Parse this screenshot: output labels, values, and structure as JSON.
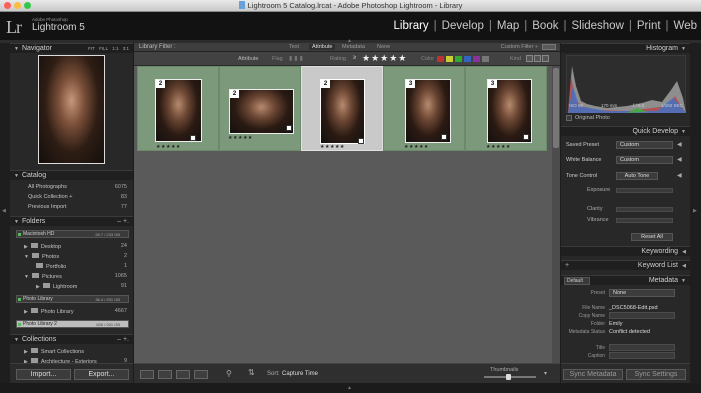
{
  "window": {
    "title": "Lightroom 5 Catalog.lrcat - Adobe Photoshop Lightroom - Library"
  },
  "identity": {
    "logo": "Lr",
    "small": "Adobe Photoshop",
    "name": "Lightroom 5"
  },
  "modules": [
    "Library",
    "Develop",
    "Map",
    "Book",
    "Slideshow",
    "Print",
    "Web"
  ],
  "active_module": "Library",
  "navigator": {
    "title": "Navigator",
    "zoom": [
      "FIT",
      "FILL",
      "1:1",
      "3:1"
    ]
  },
  "catalog": {
    "title": "Catalog",
    "items": [
      {
        "label": "All Photographs",
        "count": "6075"
      },
      {
        "label": "Quick Collection +",
        "count": "83"
      },
      {
        "label": "Previous Import",
        "count": "77"
      }
    ]
  },
  "folders": {
    "title": "Folders",
    "volume1": {
      "name": "Macintosh HD",
      "size": "28.7 / 233 GB"
    },
    "items": [
      {
        "label": "Desktop",
        "count": "24"
      },
      {
        "label": "Photos",
        "count": "2"
      },
      {
        "label": "Portfolio",
        "count": "1"
      },
      {
        "label": "Pictures",
        "count": "1065"
      },
      {
        "label": "Lightroom",
        "count": "91"
      }
    ],
    "volume2": {
      "name": "Photo Library",
      "size": "38.4 / 931 GB"
    },
    "vol2_item": {
      "label": "Photo Library",
      "count": "4667"
    },
    "volume3": {
      "name": "Photo Library 2",
      "size": "826 / 931 GB"
    }
  },
  "collections": {
    "title": "Collections",
    "items": [
      {
        "label": "Smart Collections"
      },
      {
        "label": "Architecture - Exteriors",
        "count": "9"
      }
    ]
  },
  "left_buttons": {
    "import": "Import...",
    "export": "Export..."
  },
  "filter": {
    "label": "Library Filter :",
    "tabs": [
      "Text",
      "Attribute",
      "Metadata",
      "None"
    ],
    "preset": "Custom Filter ÷",
    "attribute": "Attribute",
    "flag": "Flag",
    "rating": "Rating",
    "rating_op": "≥",
    "stars": "★★★★★",
    "color": "Color",
    "kind": "Kind"
  },
  "grid": {
    "cells": [
      {
        "index": "2",
        "stars": "★★★★★",
        "selected": false
      },
      {
        "index": "2",
        "stars": "★★★★★",
        "selected": false
      },
      {
        "index": "2",
        "stars": "★★★★★",
        "selected": true
      },
      {
        "index": "3",
        "stars": "★★★★★",
        "selected": false
      },
      {
        "index": "3",
        "stars": "★★★★★",
        "selected": false
      }
    ]
  },
  "toolbar": {
    "sort_label": "Sort:",
    "sort_value": "Capture Time",
    "thumbnails": "Thumbnails"
  },
  "histogram": {
    "title": "Histogram",
    "iso": "ISO 50",
    "focal": "170 mm",
    "aperture": "f / 8.0",
    "shutter": "1/160 SEC",
    "original": "Original Photo"
  },
  "quick_develop": {
    "title": "Quick Develop",
    "saved_preset": "Saved Preset",
    "saved_preset_value": "Custom",
    "white_balance": "White Balance",
    "white_balance_value": "Custom",
    "tone_control": "Tone Control",
    "auto_tone": "Auto Tone",
    "exposure": "Exposure",
    "clarity": "Clarity",
    "vibrance": "Vibrance",
    "reset": "Reset All"
  },
  "keywording": {
    "title": "Keywording"
  },
  "keyword_list": {
    "title": "Keyword List"
  },
  "metadata": {
    "title": "Metadata",
    "preset_dropdown": "Default",
    "preset_label": "Preset",
    "preset_value": "None",
    "fields": [
      {
        "label": "File Name",
        "value": "_DSC5068-Edit.psd"
      },
      {
        "label": "Copy Name",
        "value": ""
      },
      {
        "label": "Folder",
        "value": "Emily"
      },
      {
        "label": "Metadata Status",
        "value": "Conflict detected"
      }
    ],
    "title_label": "Title",
    "caption_label": "Caption"
  },
  "right_buttons": {
    "sync_metadata": "Sync Metadata",
    "sync_settings": "Sync Settings"
  }
}
